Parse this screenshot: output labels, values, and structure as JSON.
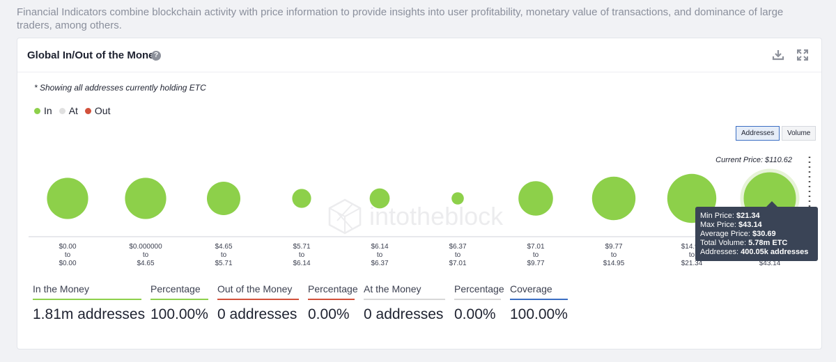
{
  "intro_text": "Financial Indicators combine blockchain activity with price information to provide insights into user profitability, monetary value of transactions, and dominance of large traders, among others.",
  "card": {
    "title": "Global In/Out of the Money",
    "help_glyph": "?",
    "download_icon": "download-icon",
    "expand_icon": "expand-icon"
  },
  "note": "* Showing all addresses currently holding ETC",
  "legend": [
    {
      "label": "In",
      "color": "#8dd04a"
    },
    {
      "label": "At",
      "color": "#e0e0e0"
    },
    {
      "label": "Out",
      "color": "#d2513b"
    }
  ],
  "toggles": {
    "addresses": "Addresses",
    "volume": "Volume",
    "active": "addresses"
  },
  "watermark": "intotheblock",
  "chart_data": {
    "type": "scatter",
    "title": "",
    "current_price_label": "Current Price: $110.62",
    "bubble_color": "#8dd04a",
    "categories": [
      {
        "from": "$0.00",
        "to": "$0.00"
      },
      {
        "from": "$0.000000",
        "to": "$4.65"
      },
      {
        "from": "$4.65",
        "to": "$5.71"
      },
      {
        "from": "$5.71",
        "to": "$6.14"
      },
      {
        "from": "$6.14",
        "to": "$6.37"
      },
      {
        "from": "$6.37",
        "to": "$7.01"
      },
      {
        "from": "$7.01",
        "to": "$9.77"
      },
      {
        "from": "$9.77",
        "to": "$14.95"
      },
      {
        "from": "$14.95",
        "to": "$21.34"
      },
      {
        "from": "$21.34",
        "to": "$43.14"
      }
    ],
    "sizes": [
      0.74,
      0.74,
      0.6,
      0.34,
      0.36,
      0.22,
      0.62,
      0.78,
      0.88,
      1.0
    ],
    "tooltip": {
      "min_price_label": "Min Price:",
      "min_price": "$21.34",
      "max_price_label": "Max Price:",
      "max_price": "$43.14",
      "avg_price_label": "Average Price:",
      "avg_price": "$30.69",
      "total_volume_label": "Total Volume:",
      "total_volume": "5.78m ETC",
      "addresses_label": "Addresses:",
      "addresses": "400.05k addresses"
    }
  },
  "stats": [
    {
      "label": "In the Money",
      "value": "1.81m addresses",
      "color": "#8dd04a"
    },
    {
      "label": "Percentage",
      "value": "100.00%",
      "color": "#8dd04a"
    },
    {
      "label": "Out of the Money",
      "value": "0 addresses",
      "color": "#d2513b"
    },
    {
      "label": "Percentage",
      "value": "0.00%",
      "color": "#d2513b"
    },
    {
      "label": "At the Money",
      "value": "0 addresses",
      "color": "#d8d8d8"
    },
    {
      "label": "Percentage",
      "value": "0.00%",
      "color": "#d8d8d8"
    },
    {
      "label": "Coverage",
      "value": "100.00%",
      "color": "#3b6ec3"
    }
  ]
}
